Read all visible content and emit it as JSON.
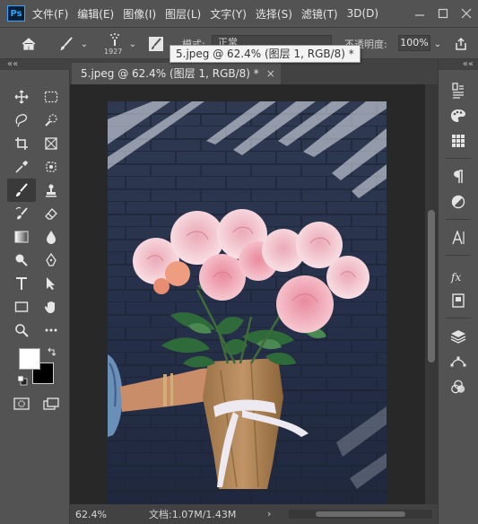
{
  "app": {
    "logo_text": "Ps",
    "menu": [
      "文件(F)",
      "编辑(E)",
      "图像(I)",
      "图层(L)",
      "文字(Y)",
      "选择(S)",
      "滤镜(T)",
      "3D(D)"
    ],
    "window_controls": [
      "minimize-icon",
      "maximize-icon",
      "close-icon"
    ]
  },
  "options_bar": {
    "brush_size": "1927",
    "mode_label": "模式:",
    "mode_value": "正常",
    "opacity_label": "不透明度:",
    "opacity_value": "100%"
  },
  "tooltip": {
    "text": "5.jpeg @ 62.4% (图层 1, RGB/8) *"
  },
  "document": {
    "tab_label": "5.jpeg @ 62.4% (图层 1, RGB/8) *",
    "close_symbol": "×"
  },
  "status": {
    "zoom": "62.4%",
    "doc_size": "文档:1.07M/1.43M",
    "arrow": "›"
  },
  "toolbar": {
    "collapse": "««",
    "tools": [
      "move-icon",
      "rect-marquee-icon",
      "lasso-icon",
      "quick-select-icon",
      "crop-icon",
      "frame-icon",
      "eyedropper-icon",
      "spot-heal-icon",
      "brush-icon",
      "stamp-icon",
      "history-brush-icon",
      "eraser-icon",
      "gradient-icon",
      "blur-icon",
      "dodge-icon",
      "pen-icon",
      "type-icon",
      "path-select-icon",
      "rectangle-icon",
      "hand-icon",
      "zoom-icon",
      "more-icon"
    ],
    "foreground_color": "#ffffff",
    "background_color": "#000000"
  },
  "right_panel": {
    "collapse": "««",
    "icons": [
      "history-icon",
      "palette-icon",
      "swatches-icon",
      "paragraph-icon",
      "adjustments-icon",
      "character-icon",
      "styles-icon",
      "properties-icon",
      "layers-icon",
      "paths-icon",
      "channels-icon"
    ]
  }
}
